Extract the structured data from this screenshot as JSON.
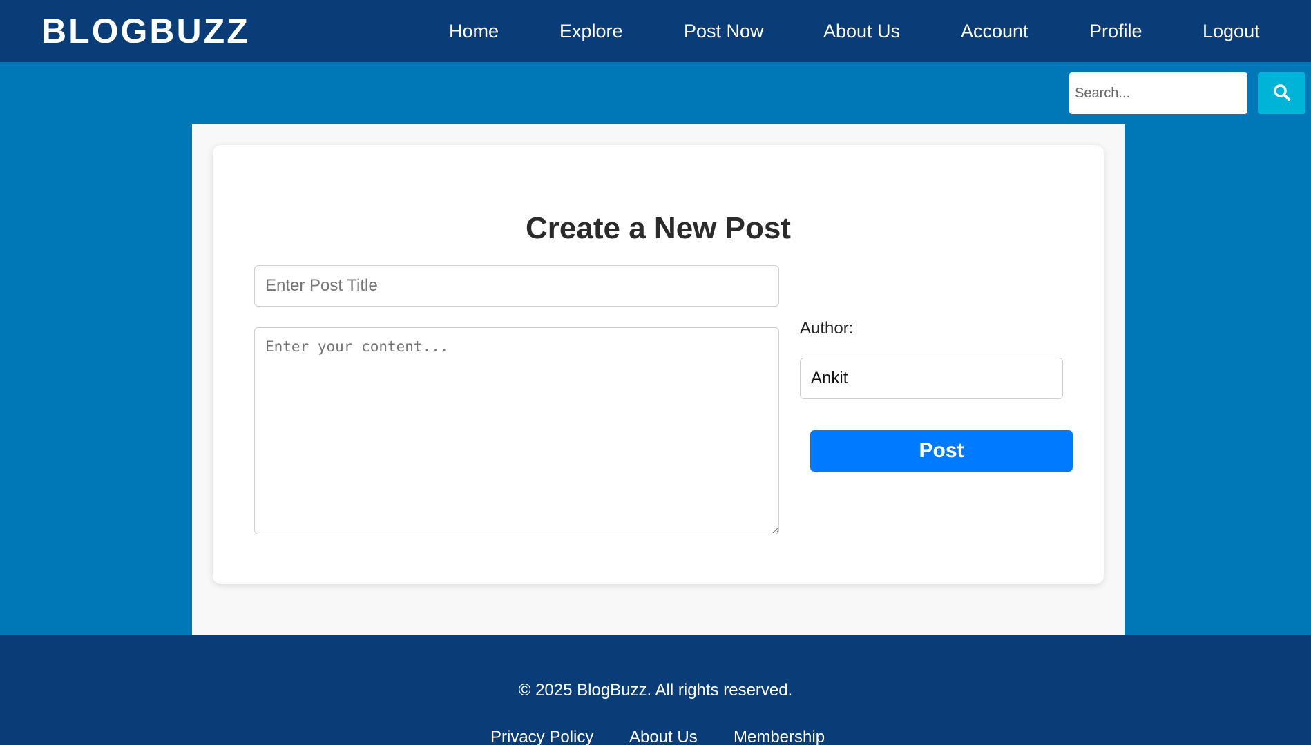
{
  "header": {
    "logo": "BLOGBUZZ",
    "nav": [
      {
        "label": "Home"
      },
      {
        "label": "Explore"
      },
      {
        "label": "Post Now"
      },
      {
        "label": "About Us"
      },
      {
        "label": "Account"
      },
      {
        "label": "Profile"
      },
      {
        "label": "Logout"
      }
    ]
  },
  "search": {
    "placeholder": "Search...",
    "button_icon": "search-icon"
  },
  "form": {
    "title": "Create a New Post",
    "title_placeholder": "Enter Post Title",
    "content_placeholder": "Enter your content...",
    "author_label": "Author:",
    "author_value": "Ankit",
    "submit_label": "Post"
  },
  "footer": {
    "copyright": "© 2025 BlogBuzz. All rights reserved.",
    "links": [
      {
        "label": "Privacy Policy"
      },
      {
        "label": "About Us"
      },
      {
        "label": "Membership"
      }
    ]
  },
  "colors": {
    "header_bg": "#0a3c78",
    "page_bg": "#0077b6",
    "search_button": "#00b4d8",
    "post_button": "#007bff"
  }
}
